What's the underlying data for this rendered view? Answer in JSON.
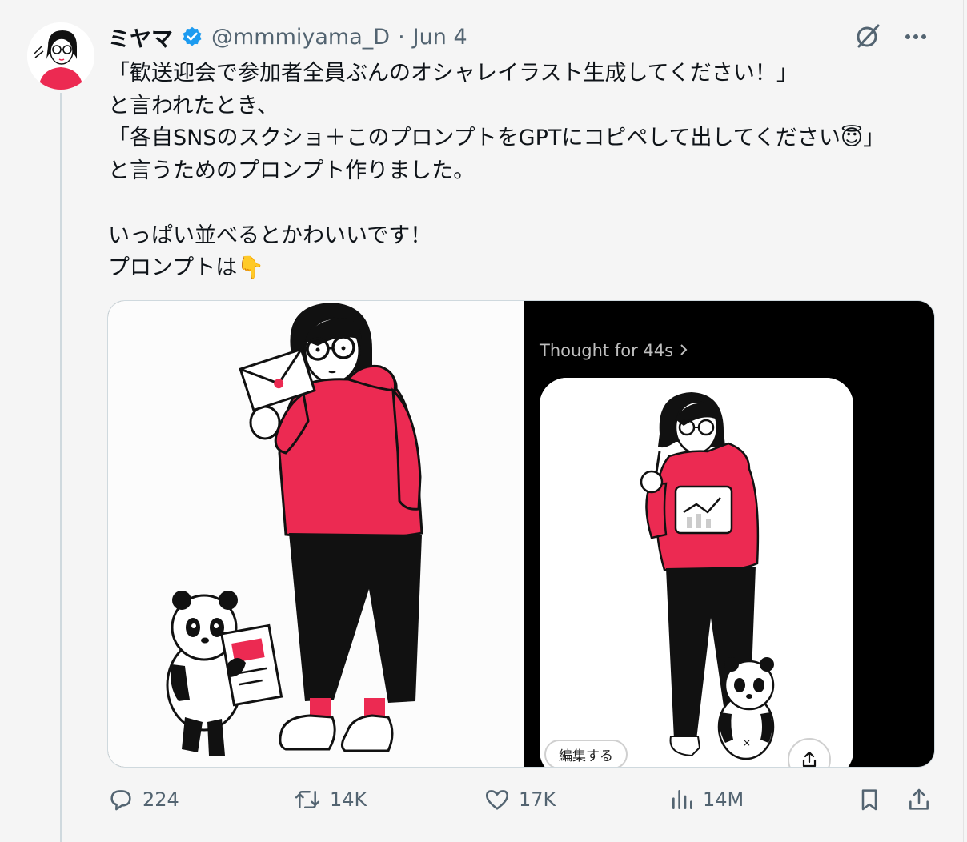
{
  "tweet": {
    "author": {
      "display_name": "ミヤマ",
      "handle": "@mmmiyama_D",
      "separator": "·",
      "date": "Jun 4",
      "verified": true
    },
    "text_lines": [
      "「歓送迎会で参加者全員ぶんのオシャレイラスト生成してください！」",
      "と言われたとき、",
      "「各自SNSのスクショ＋このプロンプトをGPTにコピペして出してください😇」",
      "と言うためのプロンプト作りました。",
      "",
      "いっぱい並べるとかわいいです！",
      "プロンプトは👇"
    ],
    "media": {
      "right_panel": {
        "thought_label": "Thought for 44s",
        "edit_button": "編集する"
      }
    },
    "metrics": {
      "replies": "224",
      "reposts": "14K",
      "likes": "17K",
      "views": "14M"
    }
  },
  "colors": {
    "hoodie": "#ec2a52",
    "verified": "#1d9bf0",
    "muted_text": "#536471"
  },
  "icons": [
    "verified-badge-icon",
    "grok-icon",
    "more-icon",
    "reply-icon",
    "repost-icon",
    "like-icon",
    "views-icon",
    "bookmark-icon",
    "share-icon"
  ]
}
